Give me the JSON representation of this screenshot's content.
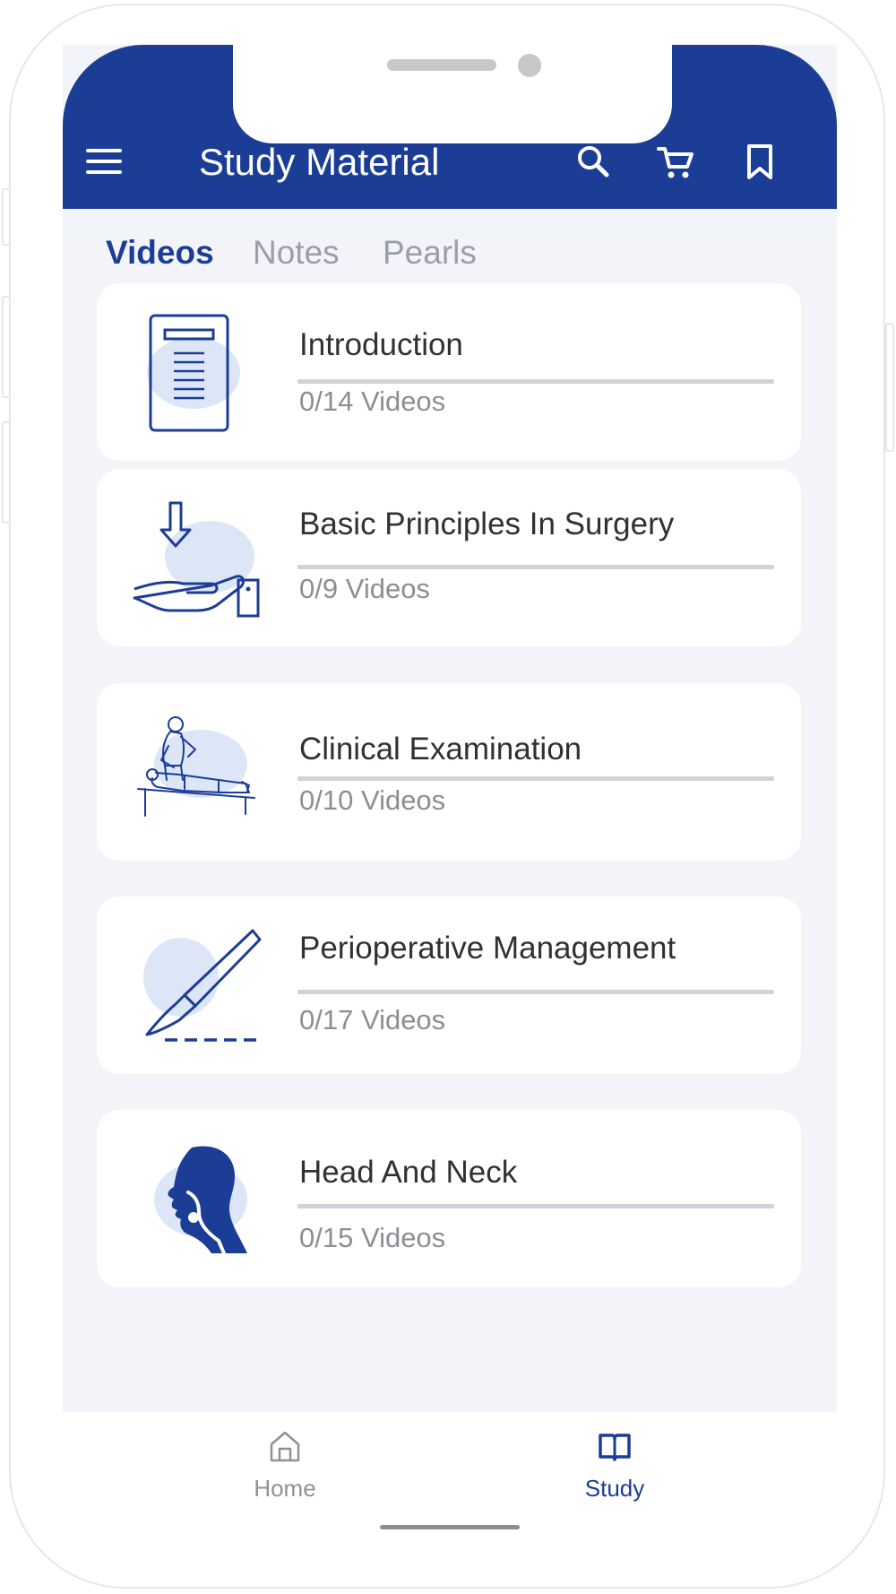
{
  "app": {
    "title": "Study Material",
    "accent_color": "#1c3d96",
    "icons": [
      "menu-icon",
      "search-icon",
      "cart-icon",
      "bookmark-icon"
    ]
  },
  "tabs": [
    {
      "label": "Videos",
      "active": true
    },
    {
      "label": "Notes",
      "active": false
    },
    {
      "label": "Pearls",
      "active": false
    }
  ],
  "topics": [
    {
      "title": "Introduction",
      "count": "0/14 Videos",
      "icon": "document-icon"
    },
    {
      "title": "Basic Principles In Surgery",
      "count": "0/9 Videos",
      "icon": "hand-arrow-icon"
    },
    {
      "title": "Clinical Examination",
      "count": "0/10 Videos",
      "icon": "doctor-patient-icon"
    },
    {
      "title": "Perioperative Management",
      "count": "0/17 Videos",
      "icon": "scalpel-icon"
    },
    {
      "title": "Head And Neck",
      "count": "0/15 Videos",
      "icon": "head-profile-icon"
    }
  ],
  "bottom_nav": [
    {
      "label": "Home",
      "icon": "home-icon",
      "active": false
    },
    {
      "label": "Study",
      "icon": "book-icon",
      "active": true
    }
  ]
}
